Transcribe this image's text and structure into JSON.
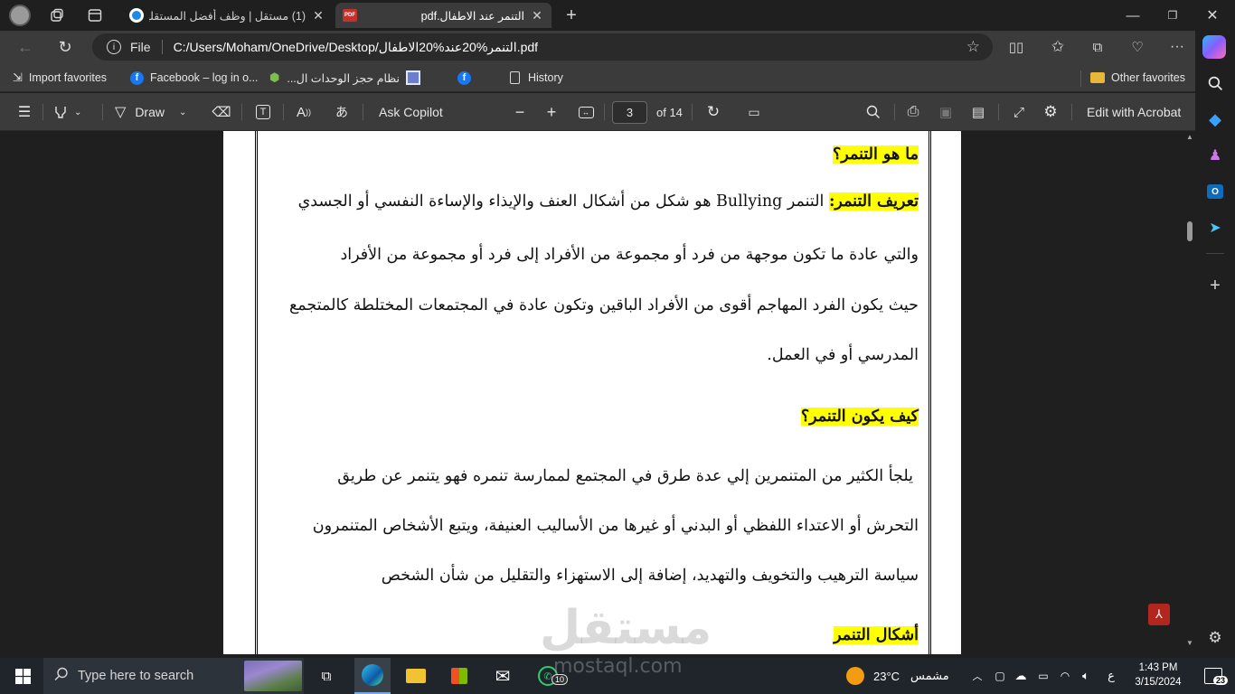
{
  "tabs": [
    {
      "title": "(1) مستقل | وظف أفضل المستقلين",
      "active": false
    },
    {
      "title": "التنمر عند الاطفال.pdf",
      "active": true
    }
  ],
  "address": {
    "scheme_label": "File",
    "url": "C:/Users/Moham/OneDrive/Desktop/التنمر%20عند%20الاطفال.pdf"
  },
  "favorites": {
    "items": [
      "Import favorites",
      "Facebook – log in o...",
      "نظام حجز الوحدات ال...",
      "History"
    ],
    "other": "Other favorites"
  },
  "pdf_toolbar": {
    "draw_label": "Draw",
    "copilot_label": "Ask Copilot",
    "page_current": "3",
    "page_total": "of 14",
    "acrobat_label": "Edit with Acrobat"
  },
  "document": {
    "heading1": "ما هو التنمر؟",
    "def_label": "تعريف التنمر:",
    "def_line1": " التنمر Bullying هو شكل من أشكال العنف والإيذاء والإساءة النفسي أو الجسدي",
    "line2": "والتي  عادة ما تكون موجهة من فرد أو مجموعة من الأفراد إلى فرد أو مجموعة من الأفراد",
    "line3": "حيث يكون الفرد المهاجم أقوى من الأفراد الباقين وتكون عادة في المجتمعات المختلطة كالمتجمع",
    "line4": "المدرسي أو في العمل.",
    "heading2": "كيف يكون التنمر؟",
    "line5": "يلجأ الكثير من المتنمرين إلي عدة طرق في المجتمع لممارسة تنمره فهو يتنمر عن طريق",
    "line6": "التحرش أو الاعتداء اللفظي أو البدني أو غيرها من الأساليب العنيفة، ويتبع الأشخاص المتنمرون",
    "line7": "سياسة الترهيب والتخويف والتهديد، إضافة إلى الاستهزاء والتقليل من شأن الشخص",
    "heading3": "أشكال التنمر"
  },
  "watermark": {
    "arabic": "مستقل",
    "latin": "mostaql.com"
  },
  "taskbar": {
    "search_placeholder": "Type here to search",
    "weather_temp": "23°C",
    "weather_desc": "مشمس",
    "lang": "ع",
    "time": "1:43 PM",
    "date": "3/15/2024",
    "whatsapp_badge": "10",
    "notif_count": "23"
  }
}
